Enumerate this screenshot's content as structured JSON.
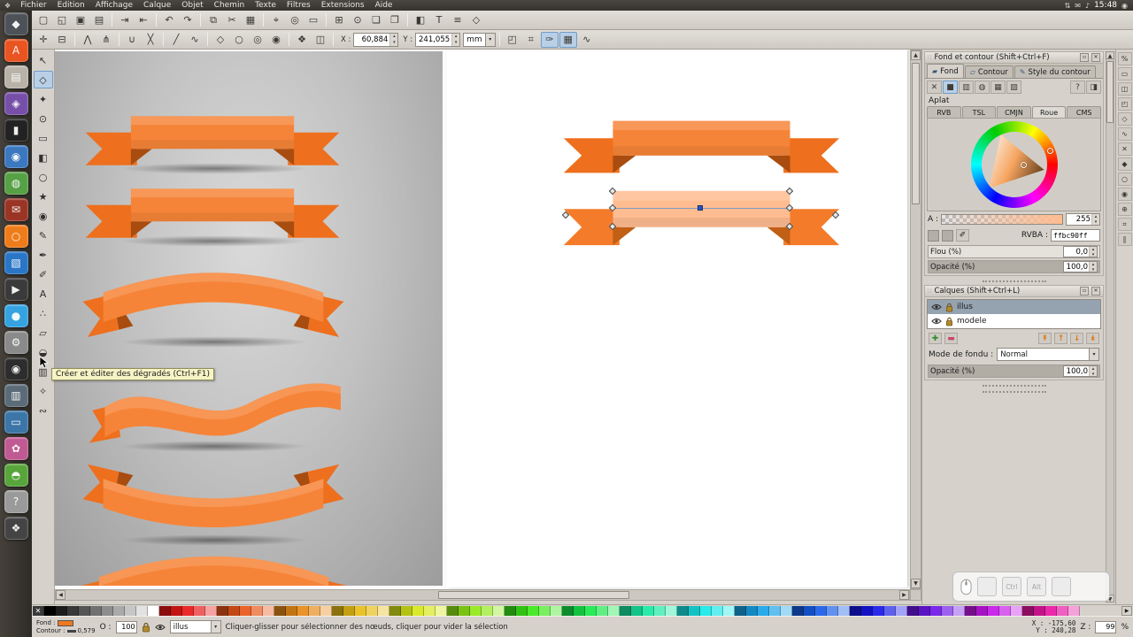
{
  "menubar": {
    "app_icon": "❖",
    "items": [
      "Fichier",
      "Edition",
      "Affichage",
      "Calque",
      "Objet",
      "Chemin",
      "Texte",
      "Filtres",
      "Extensions",
      "Aide"
    ],
    "tray": [
      {
        "name": "network-icon",
        "glyph": "⇅"
      },
      {
        "name": "mail-icon",
        "glyph": "✉"
      },
      {
        "name": "volume-icon",
        "glyph": "♪"
      }
    ],
    "clock": "15:48",
    "session_icon": "◉"
  },
  "launcher": {
    "apps": [
      {
        "name": "inkscape",
        "color": "#4d5258",
        "glyph": "◆"
      },
      {
        "name": "text-editor",
        "color": "#e95420",
        "glyph": "A"
      },
      {
        "name": "files",
        "color": "#b8b2a8",
        "glyph": "▤"
      },
      {
        "name": "software-center",
        "color": "#7650a8",
        "glyph": "◈"
      },
      {
        "name": "terminal",
        "color": "#222222",
        "glyph": "▮"
      },
      {
        "name": "firefox",
        "color": "#3b78bf",
        "glyph": "◉"
      },
      {
        "name": "web-browser",
        "color": "#56a046",
        "glyph": "◍"
      },
      {
        "name": "mail-client",
        "color": "#9a3526",
        "glyph": "✉"
      },
      {
        "name": "ubuntu-one",
        "color": "#ef7c1a",
        "glyph": "○"
      },
      {
        "name": "office",
        "color": "#2a76c6",
        "glyph": "▧"
      },
      {
        "name": "media-player",
        "color": "#3a3a3a",
        "glyph": "▶"
      },
      {
        "name": "chromium",
        "color": "#35a3e0",
        "glyph": "●"
      },
      {
        "name": "settings",
        "color": "#8a8a8a",
        "glyph": "⚙"
      },
      {
        "name": "camera",
        "color": "#2d2d2d",
        "glyph": "◉"
      },
      {
        "name": "system-monitor",
        "color": "#5b6b77",
        "glyph": "▥"
      },
      {
        "name": "display",
        "color": "#3c76a8",
        "glyph": "▭"
      },
      {
        "name": "photos",
        "color": "#c05a92",
        "glyph": "✿"
      },
      {
        "name": "games",
        "color": "#58a53c",
        "glyph": "◓"
      },
      {
        "name": "help",
        "color": "#9a9a9a",
        "glyph": "?"
      },
      {
        "name": "workspace-switcher",
        "color": "#444444",
        "glyph": "❖"
      }
    ]
  },
  "toolbar_main": {
    "icons": [
      {
        "name": "new-document-icon",
        "glyph": "▢"
      },
      {
        "name": "open-document-icon",
        "glyph": "◱"
      },
      {
        "name": "save-document-icon",
        "glyph": "▣"
      },
      {
        "name": "print-icon",
        "glyph": "▤"
      },
      {
        "sep": true
      },
      {
        "name": "import-icon",
        "glyph": "⇥"
      },
      {
        "name": "export-icon",
        "glyph": "⇤"
      },
      {
        "sep": true
      },
      {
        "name": "undo-icon",
        "glyph": "↶"
      },
      {
        "name": "redo-icon",
        "glyph": "↷"
      },
      {
        "sep": true
      },
      {
        "name": "copy-icon",
        "glyph": "⧉"
      },
      {
        "name": "cut-icon",
        "glyph": "✂"
      },
      {
        "name": "paste-icon",
        "glyph": "▦"
      },
      {
        "sep": true
      },
      {
        "name": "zoom-selection-icon",
        "glyph": "⌖"
      },
      {
        "name": "zoom-drawing-icon",
        "glyph": "◎"
      },
      {
        "name": "zoom-page-icon",
        "glyph": "▭"
      },
      {
        "sep": true
      },
      {
        "name": "duplicate-icon",
        "glyph": "⊞"
      },
      {
        "name": "clone-icon",
        "glyph": "⊙"
      },
      {
        "name": "group-icon",
        "glyph": "❏"
      },
      {
        "name": "ungroup-icon",
        "glyph": "❐"
      },
      {
        "sep": true
      },
      {
        "name": "fill-stroke-dialog-icon",
        "glyph": "◧"
      },
      {
        "name": "text-dialog-icon",
        "glyph": "T"
      },
      {
        "name": "align-dialog-icon",
        "glyph": "≡"
      },
      {
        "name": "xml-editor-icon",
        "glyph": "◇"
      }
    ]
  },
  "toolbar_node": {
    "icons": [
      {
        "name": "insert-node-icon",
        "glyph": "✛"
      },
      {
        "name": "delete-node-icon",
        "glyph": "⊟"
      },
      {
        "sep": true
      },
      {
        "name": "join-nodes-icon",
        "glyph": "⋀"
      },
      {
        "name": "break-nodes-icon",
        "glyph": "⋔"
      },
      {
        "sep": true
      },
      {
        "name": "join-segment-icon",
        "glyph": "∪"
      },
      {
        "name": "delete-segment-icon",
        "glyph": "╳"
      },
      {
        "sep": true
      },
      {
        "name": "segment-line-icon",
        "glyph": "╱"
      },
      {
        "name": "segment-curve-icon",
        "glyph": "∿"
      },
      {
        "sep": true
      },
      {
        "name": "node-cusp-icon",
        "glyph": "◇"
      },
      {
        "name": "node-smooth-icon",
        "glyph": "○"
      },
      {
        "name": "node-symmetric-icon",
        "glyph": "◎"
      },
      {
        "name": "node-auto-icon",
        "glyph": "◉"
      },
      {
        "sep": true
      },
      {
        "name": "object-to-path-icon",
        "glyph": "❖"
      },
      {
        "name": "stroke-to-path-icon",
        "glyph": "◫"
      },
      {
        "sep": true
      }
    ],
    "x_label": "X :",
    "x_value": "60,884",
    "y_label": "Y :",
    "y_value": "241,055",
    "unit": "mm",
    "toggles": [
      {
        "name": "edit-clip-path-icon",
        "glyph": "◰"
      },
      {
        "name": "show-transform-handles-icon",
        "glyph": "⌗"
      },
      {
        "name": "show-bezier-handles-icon",
        "glyph": "✑",
        "active": true
      },
      {
        "name": "show-outline-icon",
        "glyph": "▦",
        "active": true
      },
      {
        "name": "next-path-effect-icon",
        "glyph": "∿"
      }
    ]
  },
  "tools": [
    {
      "name": "selector-tool",
      "glyph": "↖"
    },
    {
      "name": "node-tool",
      "glyph": "◇",
      "active": true
    },
    {
      "name": "tweak-tool",
      "glyph": "✦"
    },
    {
      "name": "zoom-tool",
      "glyph": "⊙"
    },
    {
      "name": "rectangle-tool",
      "glyph": "▭"
    },
    {
      "name": "box3d-tool",
      "glyph": "◧"
    },
    {
      "name": "ellipse-tool",
      "glyph": "○"
    },
    {
      "name": "star-tool",
      "glyph": "★"
    },
    {
      "name": "spiral-tool",
      "glyph": "◉"
    },
    {
      "name": "pencil-tool",
      "glyph": "✎"
    },
    {
      "name": "bezier-tool",
      "glyph": "✒"
    },
    {
      "name": "calligraphy-tool",
      "glyph": "✐"
    },
    {
      "name": "text-tool",
      "glyph": "A"
    },
    {
      "name": "spray-tool",
      "glyph": "∴"
    },
    {
      "name": "eraser-tool",
      "glyph": "▱"
    },
    {
      "name": "bucket-tool",
      "glyph": "◒"
    },
    {
      "name": "gradient-tool",
      "glyph": "▥"
    },
    {
      "name": "dropper-tool",
      "glyph": "✧"
    },
    {
      "name": "connector-tool",
      "glyph": "∾"
    }
  ],
  "tooltip": {
    "text": "Créer et éditer des dégradés (Ctrl+F1)"
  },
  "fill_stroke": {
    "title": "Fond et contour (Shift+Ctrl+F)",
    "tabs": [
      "Fond",
      "Contour",
      "Style du contour"
    ],
    "tab_icons": [
      "▰",
      "▱",
      "✎"
    ],
    "fill_types": [
      {
        "name": "paint-none-button",
        "glyph": "✕"
      },
      {
        "name": "paint-flat-button",
        "glyph": "■",
        "active": true
      },
      {
        "name": "paint-linear-gradient-button",
        "glyph": "▥"
      },
      {
        "name": "paint-radial-gradient-button",
        "glyph": "◍"
      },
      {
        "name": "paint-pattern-button",
        "glyph": "▦"
      },
      {
        "name": "paint-swatch-button",
        "glyph": "▨"
      }
    ],
    "fill_types_right": [
      {
        "name": "paint-unknown-button",
        "glyph": "?"
      },
      {
        "name": "paint-alternate-button",
        "glyph": "◨"
      }
    ],
    "fill_type_label": "Aplat",
    "color_tabs": [
      "RVB",
      "TSL",
      "CMJN",
      "Roue",
      "CMS"
    ],
    "active_color_tab": "Roue",
    "alpha_label": "A :",
    "alpha_value": "255",
    "rgba_label": "RVBA :",
    "rgba_value": "ffbc90ff",
    "blur_label": "Flou (%)",
    "blur_value": "0,0",
    "opacity_label": "Opacité (%)",
    "opacity_value": "100,0"
  },
  "layers": {
    "title": "Calques (Shift+Ctrl+L)",
    "items": [
      {
        "name": "illus",
        "selected": true
      },
      {
        "name": "modele",
        "selected": false
      }
    ],
    "left_actions": [
      {
        "name": "add-layer-button",
        "glyph": "✚",
        "color": "#2e8b2e"
      },
      {
        "name": "remove-layer-button",
        "glyph": "▬",
        "color": "#cc4466"
      }
    ],
    "right_actions": [
      {
        "name": "raise-layer-top-button",
        "glyph": "↟",
        "color": "#e07818"
      },
      {
        "name": "raise-layer-button",
        "glyph": "↑",
        "color": "#e07818"
      },
      {
        "name": "lower-layer-button",
        "glyph": "↓",
        "color": "#e07818"
      },
      {
        "name": "lower-layer-bottom-button",
        "glyph": "↡",
        "color": "#e07818"
      }
    ],
    "blend_label": "Mode de fondu :",
    "blend_value": "Normal",
    "opacity_label": "Opacité (%)",
    "opacity_value": "100,0"
  },
  "snapbar": {
    "icons": [
      {
        "name": "snap-enable-icon",
        "glyph": "%"
      },
      {
        "name": "snap-bbox-icon",
        "glyph": "▭"
      },
      {
        "name": "snap-bbox-edges-icon",
        "glyph": "◫"
      },
      {
        "name": "snap-bbox-corners-icon",
        "glyph": "◰"
      },
      {
        "name": "snap-nodes-icon",
        "glyph": "◇"
      },
      {
        "name": "snap-paths-icon",
        "glyph": "∿"
      },
      {
        "name": "snap-intersections-icon",
        "glyph": "✕"
      },
      {
        "name": "snap-cusp-icon",
        "glyph": "◆"
      },
      {
        "name": "snap-smooth-icon",
        "glyph": "○"
      },
      {
        "name": "snap-midpoints-icon",
        "glyph": "◉"
      },
      {
        "name": "snap-centers-icon",
        "glyph": "⊕"
      },
      {
        "name": "snap-grid-icon",
        "glyph": "⌗"
      },
      {
        "name": "snap-guides-icon",
        "glyph": "∥"
      }
    ]
  },
  "palette": {
    "none_glyph": "✕",
    "grays": [
      "#000000",
      "#1c1c1c",
      "#383838",
      "#555555",
      "#717171",
      "#8d8d8d",
      "#aaaaaa",
      "#c6c6c6",
      "#e2e2e2",
      "#ffffff"
    ],
    "hues": [
      0,
      18,
      33,
      48,
      65,
      85,
      110,
      135,
      160,
      180,
      200,
      220,
      240,
      265,
      290,
      320
    ],
    "lightness": [
      30,
      42,
      54,
      66,
      80
    ],
    "saturation": 82
  },
  "statusbar": {
    "fill_label": "Fond :",
    "stroke_label": "Contour :",
    "stroke_value": "0,579",
    "o_label": "O :",
    "o_value": "100",
    "layer_value": "illus",
    "message": "Cliquer-glisser pour sélectionner des nœuds, cliquer pour vider la sélection",
    "x_label": "X :",
    "x_value": "-175,60",
    "y_label": "Y :",
    "y_value": "240,28",
    "z_label": "Z :",
    "z_value": "99",
    "z_unit": "%"
  },
  "overlay": {
    "keys": [
      "Ctrl",
      "Alt"
    ]
  },
  "colors": {
    "ribbon_band": "#f58234",
    "ribbon_tail": "#ee6f1d",
    "ribbon_fold": "#a84c0f",
    "selected_fill": "#ffbc90",
    "accent_orange": "#f07820"
  },
  "ui": {
    "float_glyph": "▫",
    "close_glyph": "✕",
    "spin_up": "▴",
    "spin_down": "▾",
    "combo_arrow": "▾",
    "grip_glyph": "∷",
    "scroll_up": "▲",
    "scroll_down": "▼",
    "scroll_left": "◀",
    "scroll_right": "▶"
  }
}
